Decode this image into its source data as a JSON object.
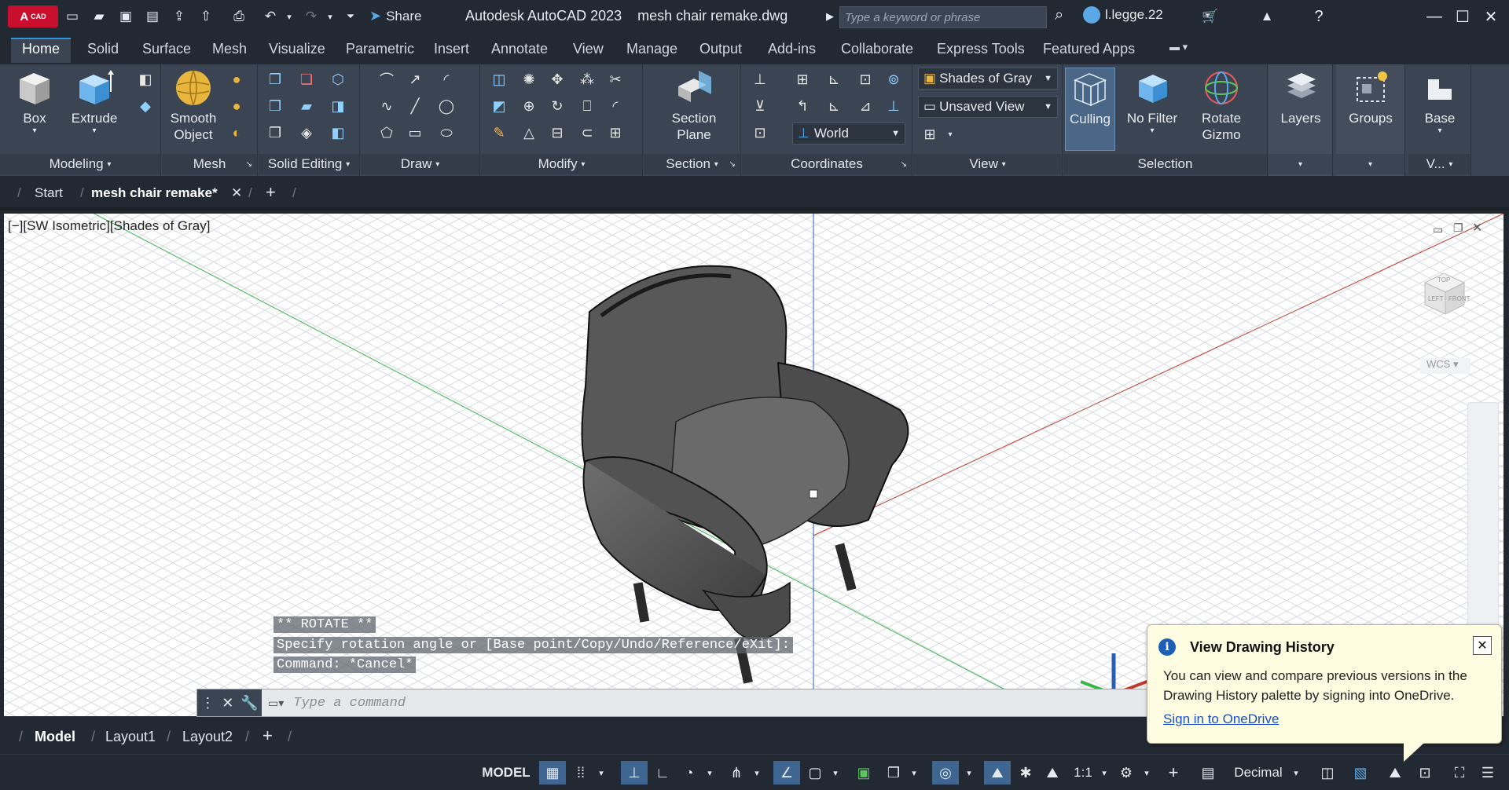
{
  "app": {
    "logo_text": "A",
    "logo_sub": "CAD",
    "share_label": "Share",
    "title": "Autodesk AutoCAD 2023    mesh chair remake.dwg",
    "search_placeholder": "Type a keyword or phrase",
    "user": "l.legge.22"
  },
  "ribbon_tabs": [
    "Home",
    "Solid",
    "Surface",
    "Mesh",
    "Visualize",
    "Parametric",
    "Insert",
    "Annotate",
    "View",
    "Manage",
    "Output",
    "Add-ins",
    "Collaborate",
    "Express Tools",
    "Featured Apps"
  ],
  "active_tab": "Home",
  "panels": {
    "modeling": {
      "title": "Modeling",
      "box": "Box",
      "extrude": "Extrude"
    },
    "mesh": {
      "title": "Mesh",
      "smooth": "Smooth",
      "smooth2": "Object"
    },
    "solid_editing": {
      "title": "Solid Editing"
    },
    "draw": {
      "title": "Draw"
    },
    "modify": {
      "title": "Modify"
    },
    "section": {
      "title": "Section",
      "plane": "Section",
      "plane2": "Plane"
    },
    "coordinates": {
      "title": "Coordinates",
      "world": "World"
    },
    "view": {
      "title": "View",
      "visual_style": "Shades of Gray",
      "saved_view": "Unsaved View"
    },
    "selection": {
      "title": "Selection",
      "culling": "Culling",
      "nofilter": "No Filter",
      "gizmo": "Rotate",
      "gizmo2": "Gizmo"
    },
    "layers": {
      "label": "Layers"
    },
    "groups": {
      "label": "Groups"
    },
    "base": {
      "label": "Base",
      "title": "V..."
    }
  },
  "doc_tabs": {
    "start": "Start",
    "active": "mesh chair remake*"
  },
  "viewport": {
    "label": "[−][SW Isometric][Shades of Gray]",
    "viewcube": {
      "top": "TOP",
      "left": "LEFT",
      "front": "FRONT",
      "wcs": "WCS"
    }
  },
  "command_history": [
    "** ROTATE **",
    "Specify rotation angle or [Base point/Copy/Undo/Reference/eXit]:",
    "Command: *Cancel*"
  ],
  "command_input_placeholder": "Type a command",
  "layout_tabs": [
    "Model",
    "Layout1",
    "Layout2"
  ],
  "status": {
    "model": "MODEL",
    "scale": "1:1",
    "units": "Decimal"
  },
  "notification": {
    "title": "View Drawing History",
    "body": "You can view and compare previous versions in the Drawing History palette by signing into OneDrive.",
    "link": "Sign in to OneDrive"
  },
  "colors": {
    "accent": "#2f95e0",
    "ribbon": "#3a4452",
    "titlebar": "#222933",
    "axis_x": "#c0392b",
    "axis_y": "#27ae60",
    "axis_z": "#2a5fb0"
  }
}
